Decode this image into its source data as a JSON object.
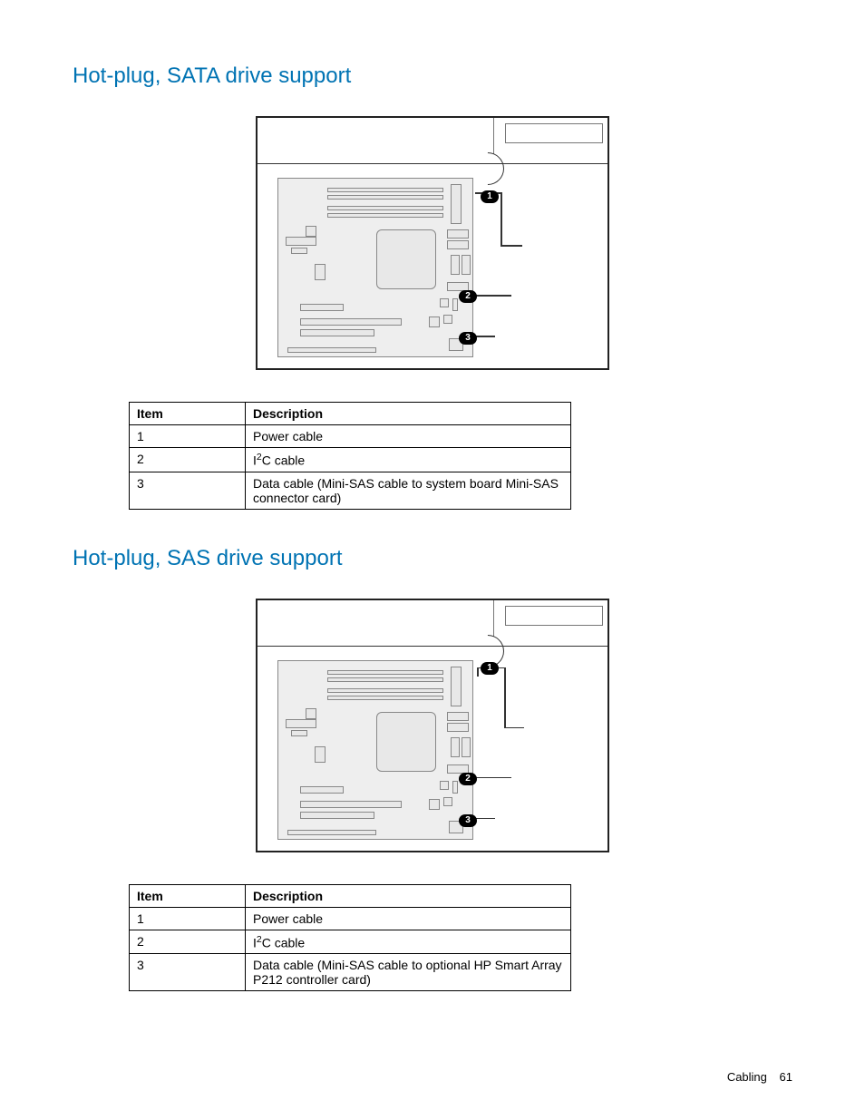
{
  "section1": {
    "heading": "Hot-plug, SATA drive support",
    "callouts": [
      "1",
      "2",
      "3"
    ],
    "table": {
      "headers": {
        "item": "Item",
        "description": "Description"
      },
      "rows": [
        {
          "item": "1",
          "description": "Power cable"
        },
        {
          "item": "2",
          "description_prefix": "I",
          "description_sup": "2",
          "description_suffix": "C cable"
        },
        {
          "item": "3",
          "description": "Data cable (Mini-SAS cable to system board Mini-SAS connector card)"
        }
      ]
    }
  },
  "section2": {
    "heading": "Hot-plug, SAS drive support",
    "callouts": [
      "1",
      "2",
      "3"
    ],
    "table": {
      "headers": {
        "item": "Item",
        "description": "Description"
      },
      "rows": [
        {
          "item": "1",
          "description": "Power cable"
        },
        {
          "item": "2",
          "description_prefix": "I",
          "description_sup": "2",
          "description_suffix": "C cable"
        },
        {
          "item": "3",
          "description": "Data cable (Mini-SAS cable to optional HP Smart Array P212 controller card)"
        }
      ]
    }
  },
  "footer": {
    "section": "Cabling",
    "page": "61"
  }
}
